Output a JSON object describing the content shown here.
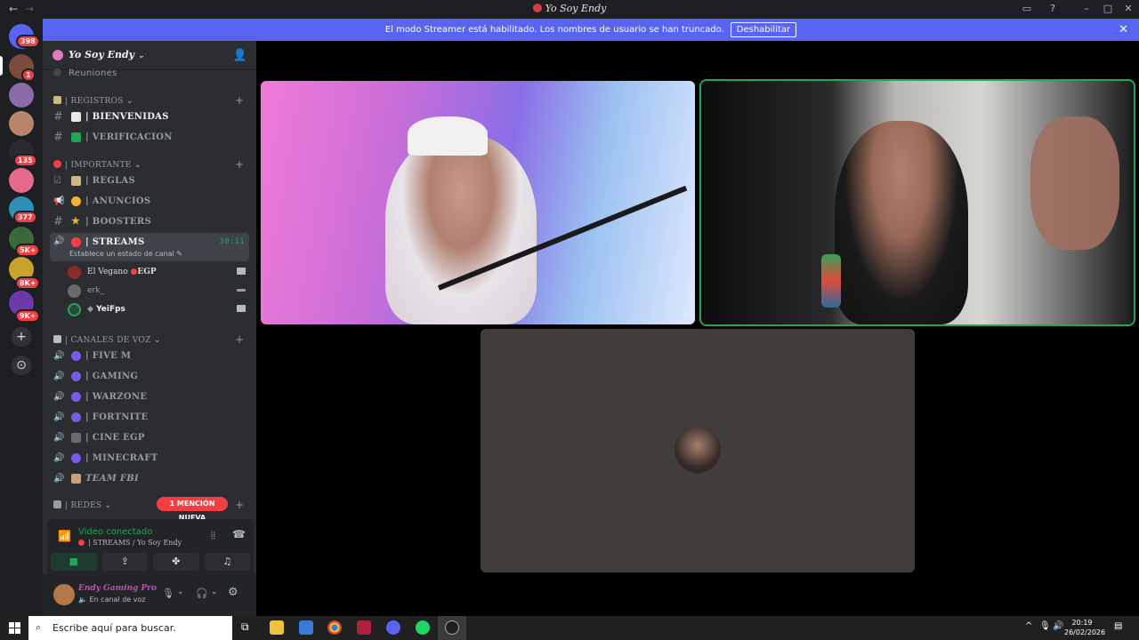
{
  "window": {
    "title": "Yo Soy Endy",
    "back_glyph": "←",
    "forward_glyph": "→",
    "icons": [
      "inbox-icon",
      "help-icon",
      "minimize-icon",
      "maximize-icon",
      "close-icon"
    ]
  },
  "rail": {
    "badges": [
      "398",
      "1",
      "135",
      "377",
      "5K+",
      "8K+",
      "9K+"
    ],
    "add_glyph": "+",
    "discover_glyph": "⊙"
  },
  "banner": {
    "text": "El modo Streamer está habilitado. Los nombres de usuario se han truncado.",
    "button": "Deshabilitar",
    "close": "✕"
  },
  "server": {
    "name": "Yo Soy Endy",
    "top_channel": "Reuniones",
    "categories": [
      {
        "label": "| REGISTROS",
        "plus": "+"
      },
      {
        "label": "| IMPORTANTE",
        "plus": "+"
      },
      {
        "label": "| CANALES DE VOZ",
        "plus": "+"
      },
      {
        "label": "| REDES",
        "plus": "+"
      }
    ],
    "text_channels": [
      {
        "label": "| BIENVENIDAS",
        "emoji_color": "#e8e8e8"
      },
      {
        "label": "| VERIFICACION",
        "emoji_color": "#23a55a"
      },
      {
        "label": "| REGLAS",
        "emoji_color": "#c9b98a"
      },
      {
        "label": "| ANUNCIOS",
        "emoji_color": "#f0b232"
      },
      {
        "label": "| BOOSTERS",
        "emoji_color": "#f0b232"
      }
    ],
    "streams": {
      "label": "| STREAMS",
      "timer": "30:11",
      "status_hint": "Establece un estado de canal"
    },
    "voice_users": [
      {
        "name": "El Vegano",
        "tag": "EGP"
      },
      {
        "name": "erk_",
        "tag": ""
      },
      {
        "name": "YeiFps",
        "tag": ""
      }
    ],
    "voice_channels": [
      {
        "label": "| FIVE M"
      },
      {
        "label": "|  GAMING"
      },
      {
        "label": "| WARZONE"
      },
      {
        "label": "| FORTNITE"
      },
      {
        "label": "| CINE EGP"
      },
      {
        "label": "| MINECRAFT"
      },
      {
        "label": "TEAM FBI"
      }
    ],
    "mention_pill": "1 MENCIÓN NUEVA"
  },
  "voice_panel": {
    "status": "Video conectado",
    "channel": "| STREAMS / Yo Soy Endy"
  },
  "user_panel": {
    "name": "Endy Gaming Pro",
    "status": "En canal de voz"
  },
  "taskbar": {
    "search_placeholder": "Escribe aquí para buscar.",
    "time": "20:19",
    "date": "26/02/2026"
  },
  "colors": {
    "accent": "#5865f2",
    "online": "#23a55a",
    "danger": "#f23f43",
    "sidebar": "#2b2d31",
    "rail": "#1e1f22"
  }
}
